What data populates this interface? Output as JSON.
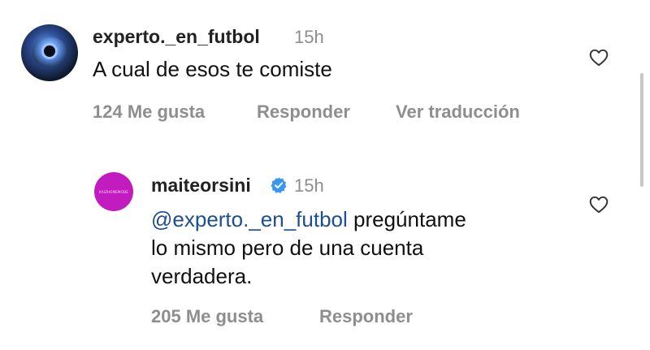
{
  "comments": [
    {
      "username": "experto._en_futbol",
      "time": "15h",
      "text": "A cual de esos te comiste",
      "likes": "124 Me gusta",
      "reply_label": "Responder",
      "translate_label": "Ver traducción",
      "avatar_icon": "profile-avatar",
      "like_icon": "heart-outline-icon"
    },
    {
      "username": "maiteorsini",
      "verified": true,
      "verified_icon": "verified-badge-icon",
      "time": "15h",
      "mention": "@experto._en_futbol",
      "text_line1_rest": " pregúntame",
      "text_line2": "lo mismo pero de una cuenta",
      "text_line3": "verdadera.",
      "likes": "205 Me gusta",
      "reply_label": "Responder",
      "avatar_text": "KAIZHOMEMODE",
      "avatar_color": "#c21cc0",
      "like_icon": "heart-outline-icon"
    }
  ],
  "colors": {
    "mention": "#1d4f8f",
    "meta": "#8e8e8e",
    "verified": "#3897f0"
  }
}
